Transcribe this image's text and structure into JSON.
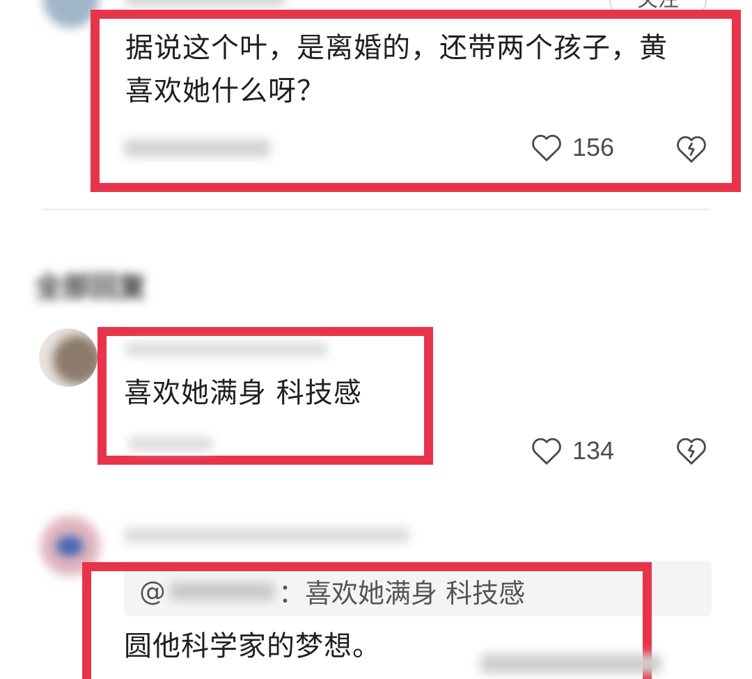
{
  "top_comment": {
    "follow_label": "关注",
    "text": "据说这个叶，是离婚的，还带两个孩子，黄喜欢她什么呀？",
    "likes": "156",
    "icons": {
      "like": "heart-outline-icon",
      "dislike": "broken-heart-icon"
    }
  },
  "replies_section": {
    "title": "全部回复"
  },
  "reply_1": {
    "text": "喜欢她满身 科技感",
    "likes": "134"
  },
  "reply_2": {
    "quoted_prefix": "@",
    "quoted_text": "：喜欢她满身 科技感",
    "text": "圆他科学家的梦想。"
  },
  "colors": {
    "highlight_border": "#e8344a",
    "text": "#1f1f1f",
    "muted": "#4d4d4d",
    "quote_background": "#f4f4f4"
  }
}
